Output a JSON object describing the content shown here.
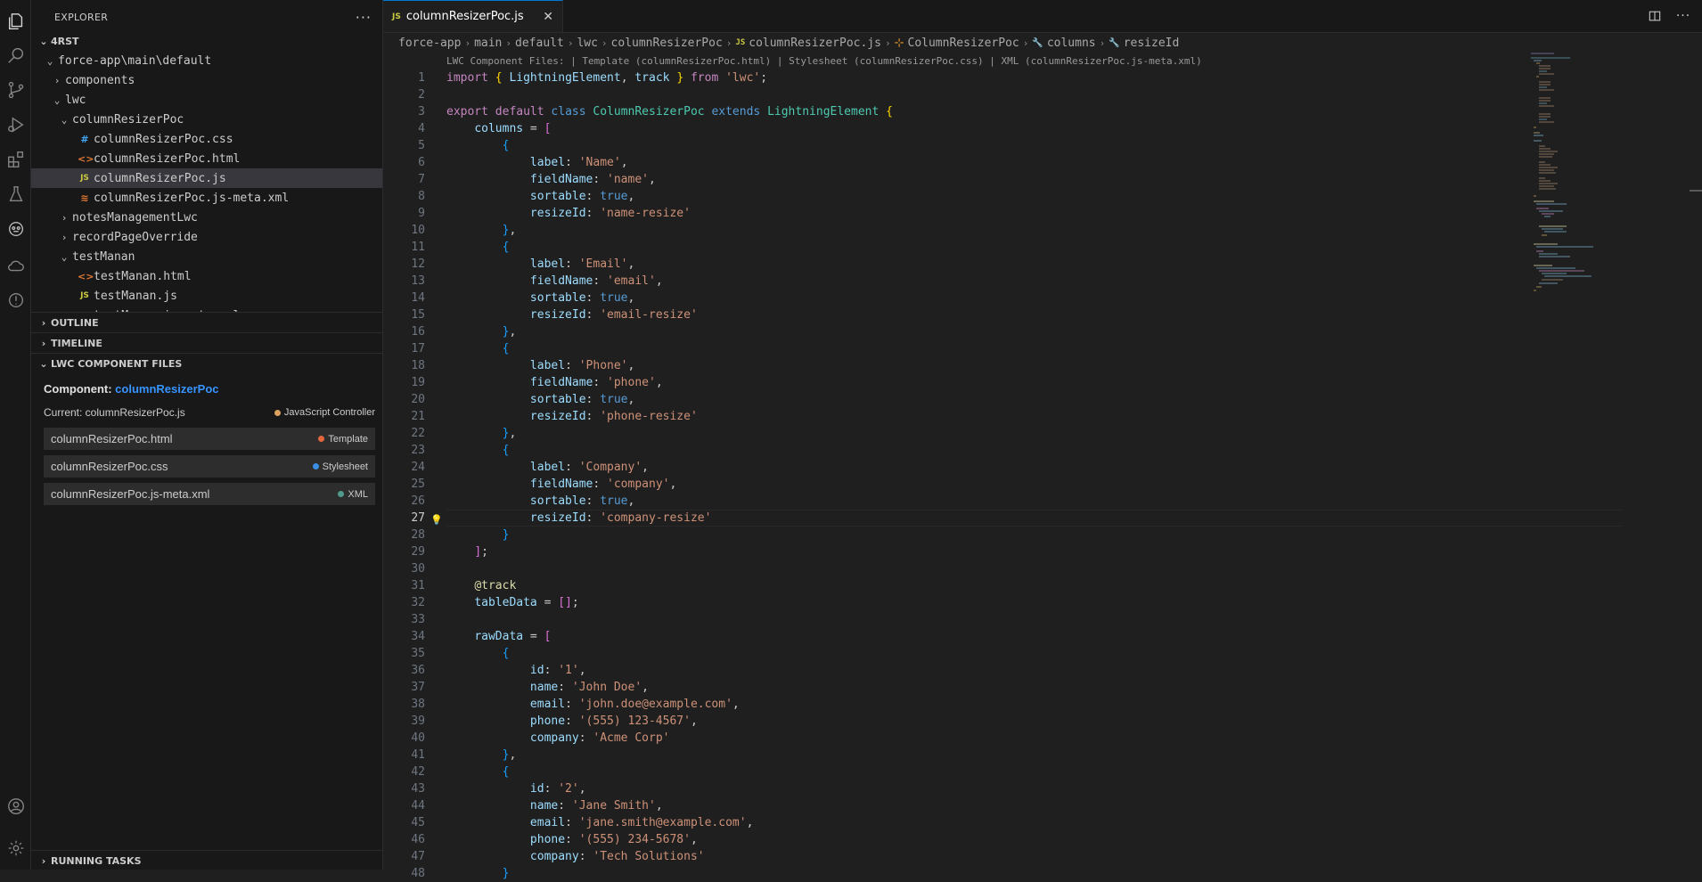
{
  "explorer": {
    "title": "EXPLORER",
    "more": "···",
    "root": "4RST",
    "tree": [
      {
        "depth": 0,
        "twist": "⌄",
        "label": "force-app\\main\\default",
        "icon": "",
        "active": false
      },
      {
        "depth": 1,
        "twist": "›",
        "label": "components",
        "icon": "",
        "active": false
      },
      {
        "depth": 1,
        "twist": "⌄",
        "label": "lwc",
        "icon": "",
        "active": false
      },
      {
        "depth": 2,
        "twist": "⌄",
        "label": "columnResizerPoc",
        "icon": "",
        "active": false
      },
      {
        "depth": 3,
        "twist": "",
        "label": "columnResizerPoc.css",
        "icon": "css",
        "active": false
      },
      {
        "depth": 3,
        "twist": "",
        "label": "columnResizerPoc.html",
        "icon": "html",
        "active": false
      },
      {
        "depth": 3,
        "twist": "",
        "label": "columnResizerPoc.js",
        "icon": "js",
        "active": true
      },
      {
        "depth": 3,
        "twist": "",
        "label": "columnResizerPoc.js-meta.xml",
        "icon": "xml",
        "active": false
      },
      {
        "depth": 2,
        "twist": "›",
        "label": "notesManagementLwc",
        "icon": "",
        "active": false
      },
      {
        "depth": 2,
        "twist": "›",
        "label": "recordPageOverride",
        "icon": "",
        "active": false
      },
      {
        "depth": 2,
        "twist": "⌄",
        "label": "testManan",
        "icon": "",
        "active": false
      },
      {
        "depth": 3,
        "twist": "",
        "label": "testManan.html",
        "icon": "html",
        "active": false
      },
      {
        "depth": 3,
        "twist": "",
        "label": "testManan.js",
        "icon": "js",
        "active": false
      },
      {
        "depth": 3,
        "twist": "",
        "label": "testManan.js-meta.xml",
        "icon": "xml",
        "active": false
      }
    ],
    "outline": "OUTLINE",
    "timeline": "TIMELINE",
    "lwc_files": "LWC COMPONENT FILES",
    "running_tasks": "RUNNING TASKS"
  },
  "lwc_panel": {
    "component_label": "Component:",
    "component_name": "columnResizerPoc",
    "current_label": "Current: columnResizerPoc.js",
    "current_badge": "JavaScript Controller",
    "current_badge_color": "#d9a25f",
    "files": [
      {
        "name": "columnResizerPoc.html",
        "type": "Template",
        "color": "#e3673a"
      },
      {
        "name": "columnResizerPoc.css",
        "type": "Stylesheet",
        "color": "#3a8ee6"
      },
      {
        "name": "columnResizerPoc.js-meta.xml",
        "type": "XML",
        "color": "#4f9a8c"
      }
    ]
  },
  "editor": {
    "tab_label": "columnResizerPoc.js",
    "tab_icon": "JS",
    "breadcrumb": [
      "force-app",
      "main",
      "default",
      "lwc",
      "columnResizerPoc",
      "columnResizerPoc.js",
      "ColumnResizerPoc",
      "columns",
      "resizeId"
    ],
    "codelens": "LWC Component Files: | Template (columnResizerPoc.html) | Stylesheet (columnResizerPoc.css) | XML (columnResizerPoc.js-meta.xml)",
    "current_line": 27
  }
}
